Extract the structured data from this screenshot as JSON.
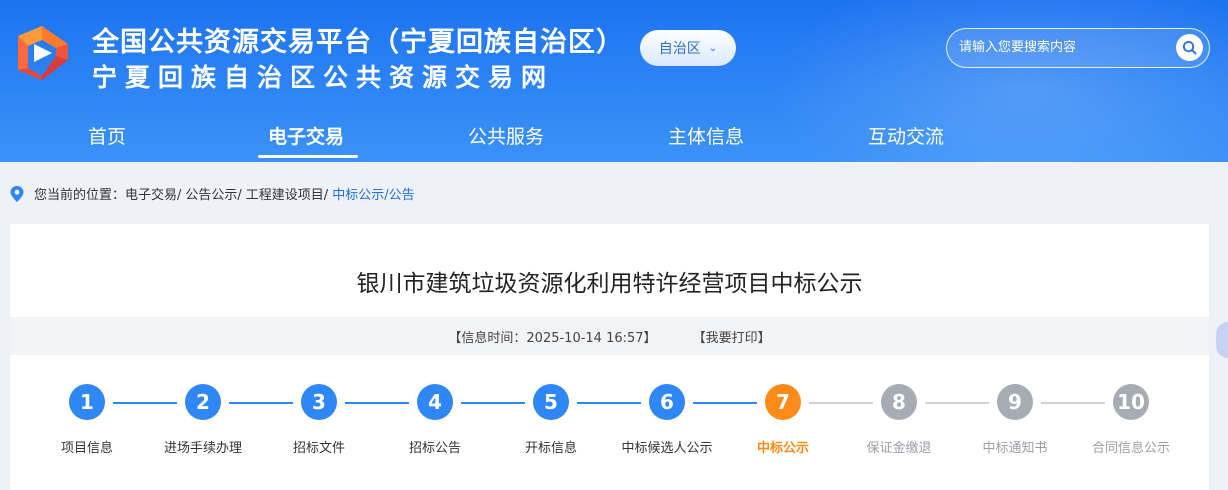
{
  "header": {
    "title_main": "全国公共资源交易平台（宁夏回族自治区）",
    "title_sub": "宁夏回族自治区公共资源交易网",
    "region": "自治区",
    "search_placeholder": "请输入您要搜索内容"
  },
  "nav": {
    "items": [
      {
        "label": "首页",
        "active": false
      },
      {
        "label": "电子交易",
        "active": true
      },
      {
        "label": "公共服务",
        "active": false
      },
      {
        "label": "主体信息",
        "active": false
      },
      {
        "label": "互动交流",
        "active": false
      }
    ]
  },
  "breadcrumb": {
    "prefix": "您当前的位置：",
    "items": [
      "电子交易/",
      "公告公示/",
      "工程建设项目/",
      "中标公示/公告"
    ]
  },
  "article": {
    "title": "银川市建筑垃圾资源化利用特许经营项目中标公示",
    "info_time": "【信息时间：2025-10-14 16:57】",
    "print_label": "【我要打印】"
  },
  "steps": [
    {
      "num": "1",
      "label": "项目信息",
      "state": "done"
    },
    {
      "num": "2",
      "label": "进场手续办理",
      "state": "done"
    },
    {
      "num": "3",
      "label": "招标文件",
      "state": "done"
    },
    {
      "num": "4",
      "label": "招标公告",
      "state": "done"
    },
    {
      "num": "5",
      "label": "开标信息",
      "state": "done"
    },
    {
      "num": "6",
      "label": "中标候选人公示",
      "state": "done"
    },
    {
      "num": "7",
      "label": "中标公示",
      "state": "current"
    },
    {
      "num": "8",
      "label": "保证金缴退",
      "state": "pending"
    },
    {
      "num": "9",
      "label": "中标通知书",
      "state": "pending"
    },
    {
      "num": "10",
      "label": "合同信息公示",
      "state": "pending"
    }
  ],
  "colors": {
    "done": "#2f86f5",
    "current": "#fb8a18",
    "pending": "#a7abb3",
    "done_line": "#2f86f5",
    "pending_line": "#cfd3d9",
    "done_text": "#333333",
    "current_text": "#fb8a18",
    "pending_text": "#9a9ea5"
  },
  "icons": {
    "logo": "platform-logo",
    "location": "location-pin-icon",
    "search": "search-icon",
    "chevron": "chevron-down-icon"
  }
}
